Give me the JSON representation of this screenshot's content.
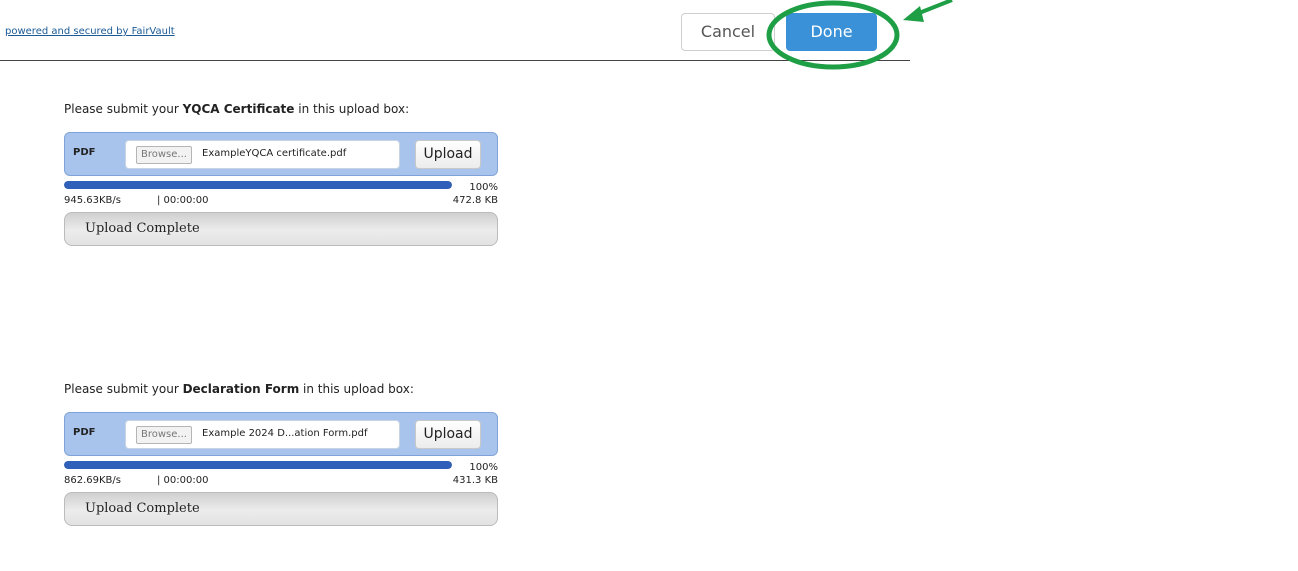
{
  "header": {
    "powered_text": "powered and secured by FairVault",
    "cancel_label": "Cancel",
    "done_label": "Done"
  },
  "annotation_color": "#1e9e45",
  "uploads": [
    {
      "prompt_before": "Please submit your ",
      "document_name": "YQCA Certificate",
      "prompt_after": " in this upload box:",
      "file_type": "PDF",
      "browse_label": "Browse...",
      "file_name": "ExampleYQCA certificate.pdf",
      "upload_label": "Upload",
      "progress_percent": 100,
      "progress_text": "100%",
      "speed": "945.63KB/s",
      "elapsed": "| 00:00:00",
      "size": "472.8 KB",
      "status": "Upload Complete"
    },
    {
      "prompt_before": "Please submit your ",
      "document_name": "Declaration Form",
      "prompt_after": " in this upload box:",
      "file_type": "PDF",
      "browse_label": "Browse...",
      "file_name": "Example 2024 D...ation Form.pdf",
      "upload_label": "Upload",
      "progress_percent": 100,
      "progress_text": "100%",
      "speed": "862.69KB/s",
      "elapsed": "| 00:00:00",
      "size": "431.3 KB",
      "status": "Upload Complete"
    }
  ]
}
